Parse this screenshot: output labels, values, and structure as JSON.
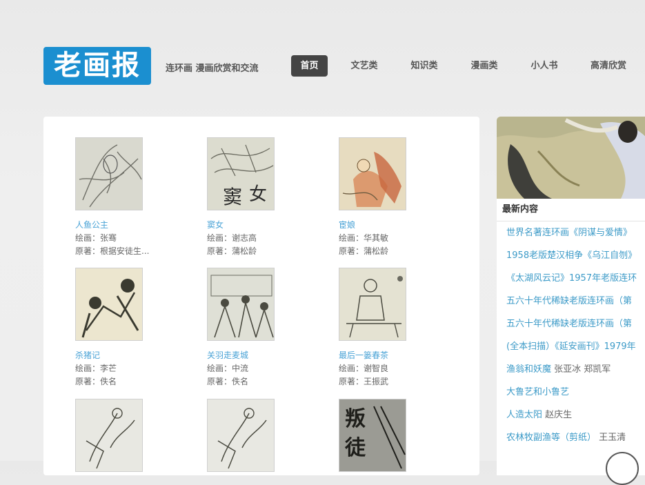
{
  "header": {
    "logo_text": "老画报",
    "tagline": "连环画 漫画欣赏和交流"
  },
  "nav": [
    {
      "label": "首页",
      "active": true
    },
    {
      "label": "文艺类",
      "active": false
    },
    {
      "label": "知识类",
      "active": false
    },
    {
      "label": "漫画类",
      "active": false
    },
    {
      "label": "小人书",
      "active": false
    },
    {
      "label": "高清欣赏",
      "active": false
    }
  ],
  "books": [
    {
      "title": "人鱼公主",
      "artist": "绘画：张骞",
      "author": "原著：根据安徒生..."
    },
    {
      "title": "窦女",
      "artist": "绘画：谢志高",
      "author": "原著：蒲松龄"
    },
    {
      "title": "宦娘",
      "artist": "绘画：华其敏",
      "author": "原著：蒲松龄"
    },
    {
      "title": "杀猪记",
      "artist": "绘画：李芒",
      "author": "原著：佚名"
    },
    {
      "title": "关羽走麦城",
      "artist": "绘画：中流",
      "author": "原著：佚名"
    },
    {
      "title": "最后一篓春茶",
      "artist": "绘画：谢智良",
      "author": "原著：王振武"
    },
    {
      "title": "",
      "artist": "",
      "author": ""
    },
    {
      "title": "",
      "artist": "",
      "author": ""
    },
    {
      "title": "",
      "artist": "",
      "author": ""
    }
  ],
  "thumb_glyphs": [
    "窦",
    "女",
    "叛",
    "徒"
  ],
  "sidebar": {
    "heading": "最新内容",
    "items": [
      {
        "text": "世界名著连环画《阴谋与爱情》",
        "author": ""
      },
      {
        "text": "1958老版楚汉相争《乌江自刎》",
        "author": ""
      },
      {
        "text": "《太湖风云记》1957年老版连环",
        "author": ""
      },
      {
        "text": "五六十年代稀缺老版连环画（第",
        "author": ""
      },
      {
        "text": "五六十年代稀缺老版连环画（第",
        "author": ""
      },
      {
        "text": "(全本扫描）《延安画刊》1979年",
        "author": ""
      },
      {
        "text": "渔翁和妖魔",
        "author": "张亚冰 郑凯军"
      },
      {
        "text": "大鲁艺和小鲁艺",
        "author": ""
      },
      {
        "text": "人造太阳",
        "author": "赵庆生"
      },
      {
        "text": "农林牧副渔等（剪纸）",
        "author": "王玉清"
      }
    ]
  }
}
